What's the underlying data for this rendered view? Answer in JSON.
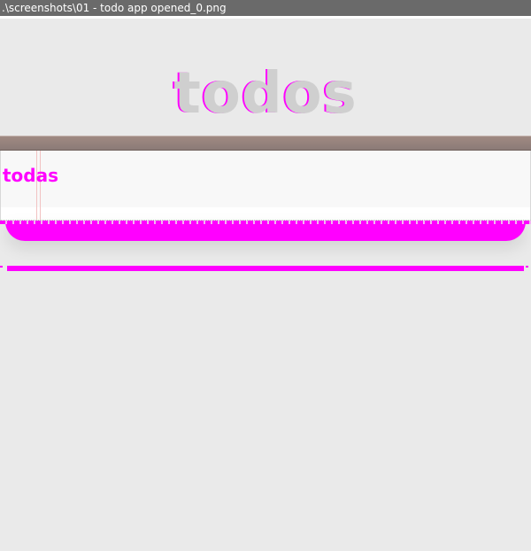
{
  "window": {
    "title": ".\\screenshots\\01 - todo app opened_0.png"
  },
  "app": {
    "heading": "todos"
  },
  "new_todo": {
    "value": "todas",
    "placeholder": ""
  },
  "colors": {
    "titlebar": "#6a6a6a",
    "page_background": "#eaeaea",
    "heading": "#cfcfcf",
    "panel_topbar": "#8b7b77",
    "panel_body": "#f8f8f8",
    "highlight": "#ff00ff"
  }
}
